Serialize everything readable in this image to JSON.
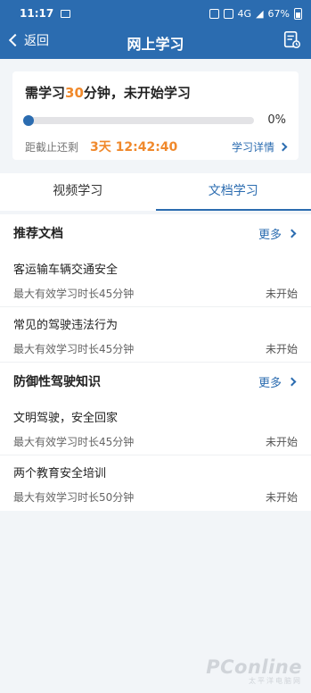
{
  "status_bar": {
    "time": "11:17",
    "network": "4G",
    "battery": "67%"
  },
  "header": {
    "back_label": "返回",
    "title": "网上学习"
  },
  "summary": {
    "title_prefix": "需学习",
    "minutes": "30",
    "title_suffix": "分钟，未开始学习",
    "progress_percent": 0,
    "progress_label": "0%",
    "deadline_label": "距截止还剩",
    "countdown": "3天 12:42:40",
    "detail_label": "学习详情"
  },
  "tabs": [
    {
      "label": "视频学习",
      "active": false
    },
    {
      "label": "文档学习",
      "active": true
    }
  ],
  "sections": [
    {
      "title": "推荐文档",
      "more_label": "更多",
      "items": [
        {
          "title": "客运输车辆交通安全",
          "meta": "最大有效学习时长45分钟",
          "status": "未开始"
        },
        {
          "title": "常见的驾驶违法行为",
          "meta": "最大有效学习时长45分钟",
          "status": "未开始"
        }
      ]
    },
    {
      "title": "防御性驾驶知识",
      "more_label": "更多",
      "items": [
        {
          "title": "文明驾驶，安全回家",
          "meta": "最大有效学习时长45分钟",
          "status": "未开始"
        },
        {
          "title": "两个教育安全培训",
          "meta": "最大有效学习时长50分钟",
          "status": "未开始"
        }
      ]
    }
  ],
  "watermark": {
    "main": "PConline",
    "sub": "太平洋电脑网"
  },
  "colors": {
    "primary": "#2b6cb0",
    "accent": "#f0892c",
    "background": "#f2f5f8"
  }
}
